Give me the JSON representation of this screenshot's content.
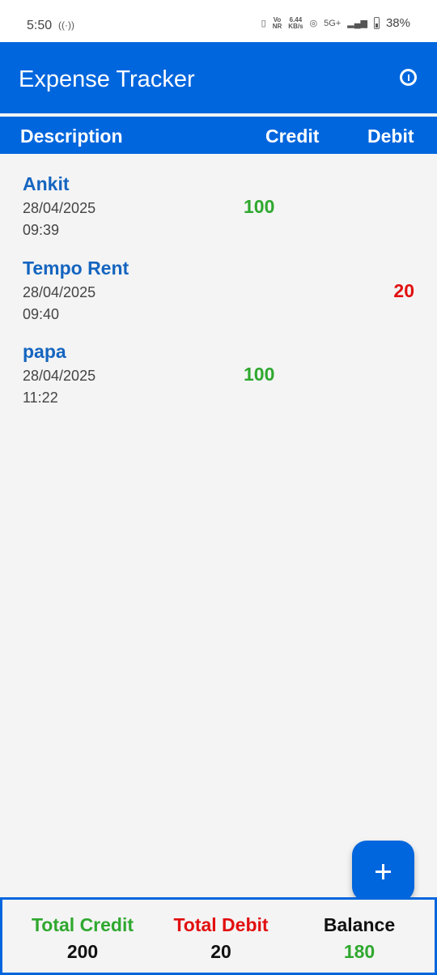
{
  "status_bar": {
    "time": "5:50",
    "network_speed_value": "6.44",
    "network_speed_unit": "KB/s",
    "network_type": "5G+",
    "battery": "38%",
    "icons": [
      "hotspot-icon",
      "vibrate-icon",
      "vonr-icon",
      "wifi-calling-icon",
      "signal-icon",
      "battery-icon"
    ]
  },
  "app": {
    "title": "Expense Tracker",
    "accent_color": "#0066dd"
  },
  "table_header": {
    "description": "Description",
    "credit": "Credit",
    "debit": "Debit"
  },
  "transactions": [
    {
      "name": "Ankit",
      "date": "28/04/2025",
      "time": "09:39",
      "credit": "100",
      "debit": ""
    },
    {
      "name": "Tempo Rent",
      "date": "28/04/2025",
      "time": "09:40",
      "credit": "",
      "debit": "20"
    },
    {
      "name": "papa",
      "date": "28/04/2025",
      "time": "11:22",
      "credit": "100",
      "debit": ""
    }
  ],
  "totals": {
    "credit_label": "Total Credit",
    "credit_value": "200",
    "debit_label": "Total Debit",
    "debit_value": "20",
    "balance_label": "Balance",
    "balance_value": "180"
  },
  "colors": {
    "credit": "#2fa82f",
    "debit": "#e20f0f",
    "name": "#1565c0"
  }
}
